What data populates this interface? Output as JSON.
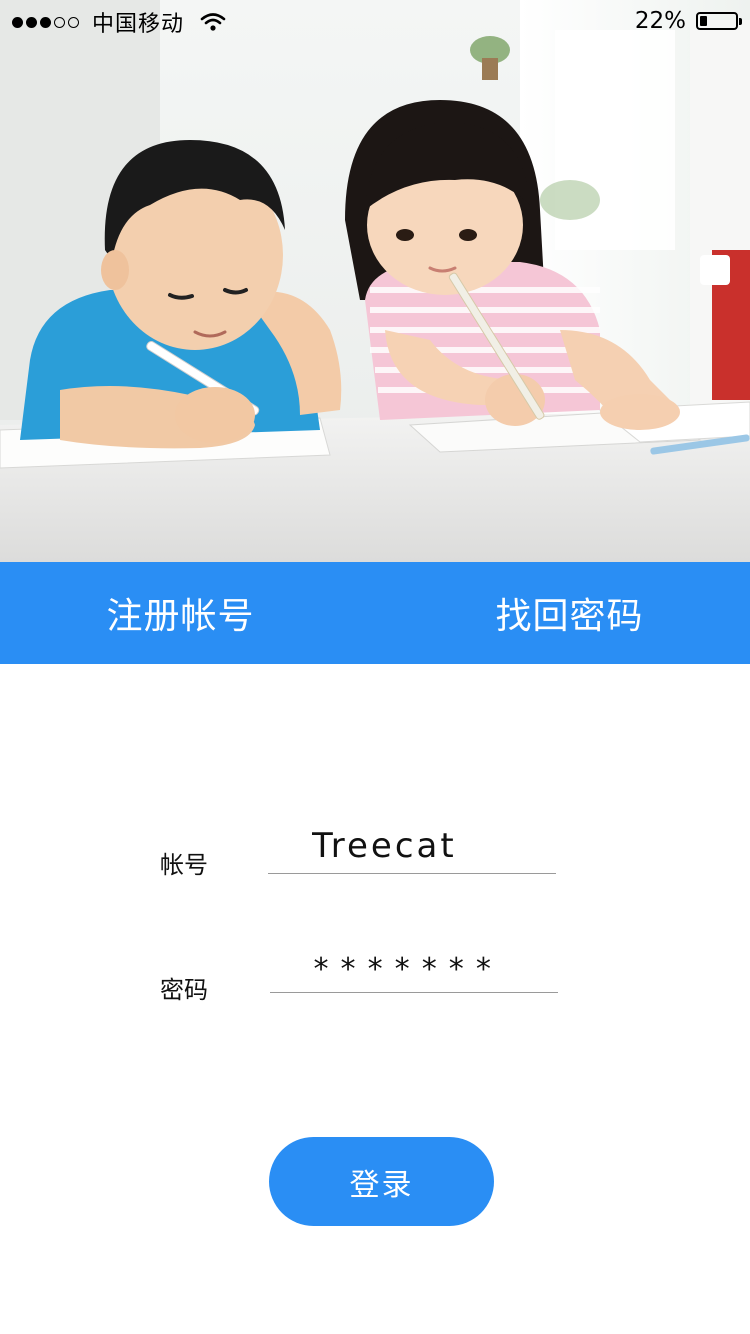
{
  "status_bar": {
    "carrier": "中国移动",
    "signal_bars_filled": 3,
    "signal_bars_total": 5,
    "battery_percent_label": "22%",
    "battery_level": 0.22
  },
  "hero": {
    "image_description_icon": "children-studying-photo"
  },
  "action_bar": {
    "register_label": "注册帐号",
    "recover_label": "找回密码",
    "background_color": "#2a8ef4"
  },
  "form": {
    "account_label": "帐号",
    "account_value": "Treecat",
    "password_label": "密码",
    "password_mask": "*******"
  },
  "login": {
    "label": "登录",
    "background_color": "#2a8ef4"
  }
}
